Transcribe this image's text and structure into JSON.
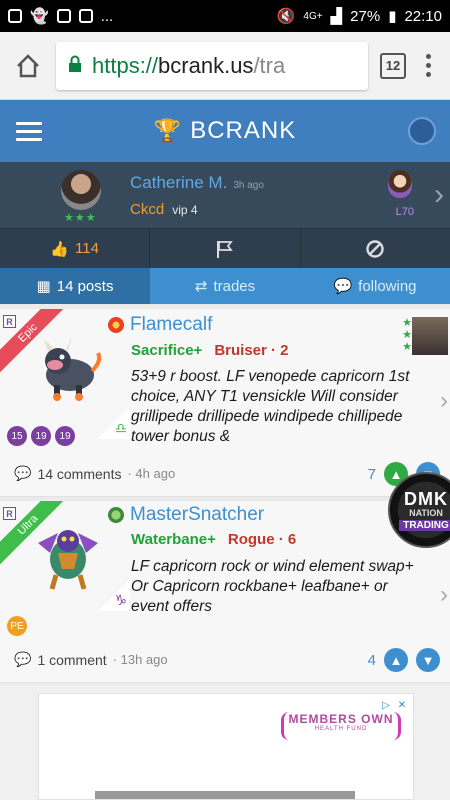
{
  "status_bar": {
    "battery": "27%",
    "time": "22:10",
    "network": "4G+",
    "dots": "..."
  },
  "browser": {
    "url_scheme": "https://",
    "url_host": "bcrank.us",
    "url_path": "/tra",
    "tab_count": "12"
  },
  "app": {
    "brand": "BCRANK"
  },
  "profile": {
    "name": "Catherine M.",
    "time": "3h ago",
    "clan": "Ckcd",
    "vip": "vip 4",
    "level": "L70",
    "stars": "★★★"
  },
  "actions": {
    "likes": "114"
  },
  "tabs": [
    {
      "label": "14 posts",
      "active": true
    },
    {
      "label": "trades",
      "active": false
    },
    {
      "label": "following",
      "active": false
    }
  ],
  "posts": [
    {
      "rarity": "Epic",
      "badge": "R",
      "title": "Flamecalf",
      "tag1": "Sacrifice+",
      "tag2": "Bruiser · 2",
      "text": "53+9 r boost. LF venopede capricorn 1st choice, ANY T1 vensickle Will consider grillipede drillipede windipede chillipede tower bonus &",
      "levels": [
        "15",
        "19",
        "19"
      ],
      "comments": "14 comments",
      "time": "· 4h ago",
      "votes": "7",
      "element_symbol": "♎"
    },
    {
      "rarity": "Ultra",
      "badge": "R",
      "title": "MasterSnatcher",
      "tag1": "Waterbane+",
      "tag2": "Rogue · 6",
      "text": "LF capricorn rock or wind element swap+ Or Capricorn rockbane+ leafbane+ or event offers",
      "levels": [
        "PE"
      ],
      "comments": "1 comment",
      "time": "· 13h ago",
      "votes": "4",
      "element_symbol": "♑"
    }
  ],
  "overlay": {
    "line1": "DMK",
    "line2": "NATION",
    "line3": "TRADING"
  },
  "ad": {
    "line1": "MEMBERS OWN",
    "line2": "HEALTH FUND"
  }
}
